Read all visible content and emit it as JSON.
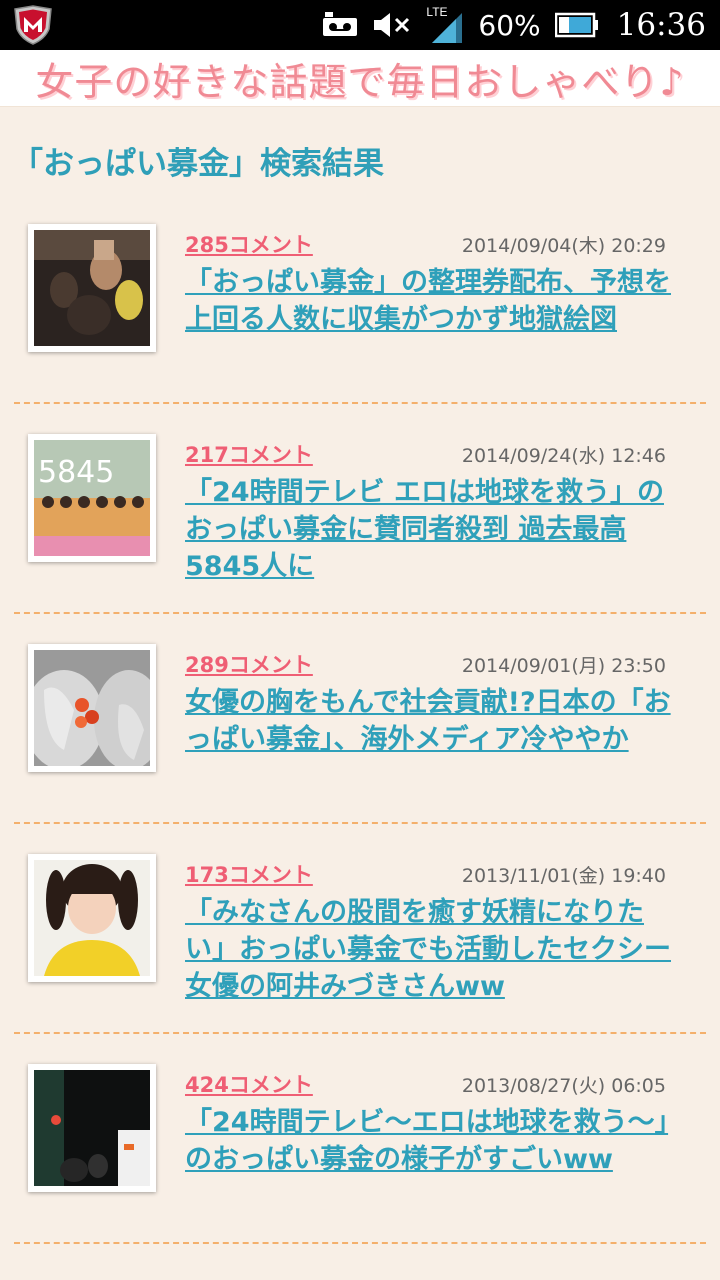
{
  "statusbar": {
    "battery": "60%",
    "time": "16:36",
    "network": "LTE"
  },
  "banner": {
    "text": "女子の好きな話題で毎日おしゃべり♪"
  },
  "heading": "「おっぱい募金」検索結果",
  "results": [
    {
      "comments": "285コメント",
      "date": "2014/09/04(木) 20:29",
      "title": "「おっぱい募金」の整理券配布、予想を上回る人数に収集がつかず地獄絵図"
    },
    {
      "comments": "217コメント",
      "date": "2014/09/24(水) 12:46",
      "title": "「24時間テレビ エロは地球を救う」のおっぱい募金に賛同者殺到 過去最高5845人に",
      "thumb_text": "5845"
    },
    {
      "comments": "289コメント",
      "date": "2014/09/01(月) 23:50",
      "title": "女優の胸をもんで社会貢献!?日本の「おっぱい募金」、海外メディア冷ややか"
    },
    {
      "comments": "173コメント",
      "date": "2013/11/01(金) 19:40",
      "title": "「みなさんの股間を癒す妖精になりたい」おっぱい募金でも活動したセクシー女優の阿井みづきさんww"
    },
    {
      "comments": "424コメント",
      "date": "2013/08/27(火) 06:05",
      "title": "「24時間テレビ～エロは地球を救う～」のおっぱい募金の様子がすごいww"
    }
  ],
  "colors": {
    "accent": "#2fa0ba",
    "comment": "#ef5e74",
    "divider": "#f4b06c",
    "banner_text": "#f08a94",
    "background": "#f8efe6"
  }
}
